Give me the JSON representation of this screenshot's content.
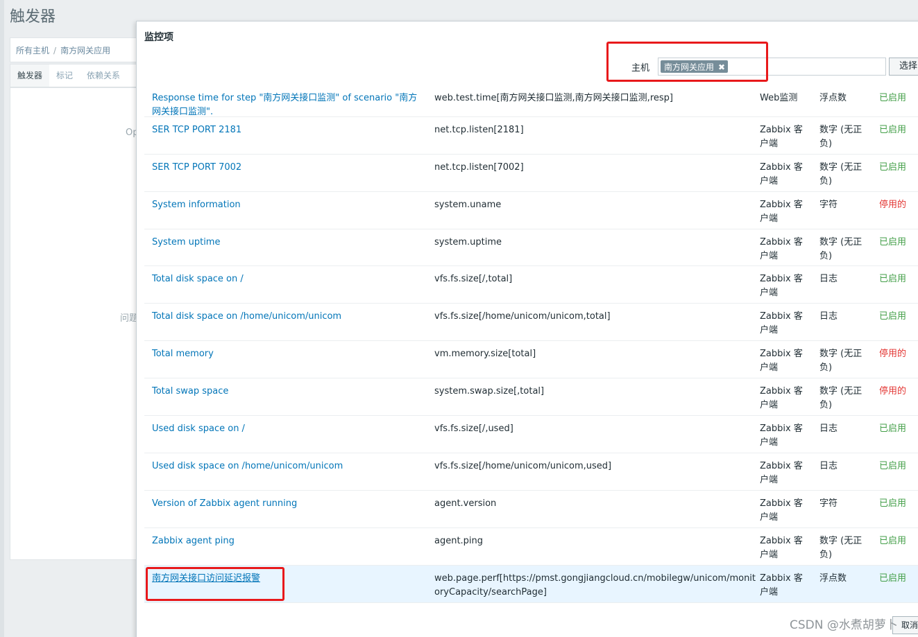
{
  "page": {
    "title": "触发器",
    "breadcrumb": [
      "所有主机",
      "南方网关应用"
    ],
    "tabs": [
      "触发器",
      "标记",
      "依赖关系"
    ],
    "fragments": [
      "Op",
      "问题"
    ]
  },
  "dialog": {
    "title": "监控项",
    "host_label": "主机",
    "host_chip": "南方网关应用",
    "select_label": "选择",
    "cancel_label": "取消"
  },
  "items": [
    {
      "name": "Response time for step \"南方网关接口监测\" of scenario \"南方网关接口监测\".",
      "key": "web.test.time[南方网关接口监测,南方网关接口监测,resp]",
      "type": "Web监测",
      "vtype": "浮点数",
      "status": "已启用",
      "enabled": true
    },
    {
      "name": "SER TCP PORT 2181",
      "key": "net.tcp.listen[2181]",
      "type": "Zabbix 客户端",
      "vtype": "数字 (无正负)",
      "status": "已启用",
      "enabled": true
    },
    {
      "name": "SER TCP PORT 7002",
      "key": "net.tcp.listen[7002]",
      "type": "Zabbix 客户端",
      "vtype": "数字 (无正负)",
      "status": "已启用",
      "enabled": true
    },
    {
      "name": "System information",
      "key": "system.uname",
      "type": "Zabbix 客户端",
      "vtype": "字符",
      "status": "停用的",
      "enabled": false
    },
    {
      "name": "System uptime",
      "key": "system.uptime",
      "type": "Zabbix 客户端",
      "vtype": "数字 (无正负)",
      "status": "已启用",
      "enabled": true
    },
    {
      "name": "Total disk space on /",
      "key": "vfs.fs.size[/,total]",
      "type": "Zabbix 客户端",
      "vtype": "日志",
      "status": "已启用",
      "enabled": true
    },
    {
      "name": "Total disk space on /home/unicom/unicom",
      "key": "vfs.fs.size[/home/unicom/unicom,total]",
      "type": "Zabbix 客户端",
      "vtype": "日志",
      "status": "已启用",
      "enabled": true
    },
    {
      "name": "Total memory",
      "key": "vm.memory.size[total]",
      "type": "Zabbix 客户端",
      "vtype": "数字 (无正负)",
      "status": "停用的",
      "enabled": false
    },
    {
      "name": "Total swap space",
      "key": "system.swap.size[,total]",
      "type": "Zabbix 客户端",
      "vtype": "数字 (无正负)",
      "status": "停用的",
      "enabled": false
    },
    {
      "name": "Used disk space on /",
      "key": "vfs.fs.size[/,used]",
      "type": "Zabbix 客户端",
      "vtype": "日志",
      "status": "已启用",
      "enabled": true
    },
    {
      "name": "Used disk space on /home/unicom/unicom",
      "key": "vfs.fs.size[/home/unicom/unicom,used]",
      "type": "Zabbix 客户端",
      "vtype": "日志",
      "status": "已启用",
      "enabled": true
    },
    {
      "name": "Version of Zabbix agent running",
      "key": "agent.version",
      "type": "Zabbix 客户端",
      "vtype": "字符",
      "status": "已启用",
      "enabled": true
    },
    {
      "name": "Zabbix agent ping",
      "key": "agent.ping",
      "type": "Zabbix 客户端",
      "vtype": "数字 (无正负)",
      "status": "已启用",
      "enabled": true
    },
    {
      "name": "南方网关接口访问延迟报警",
      "key": "web.page.perf[https://pmst.gongjiangcloud.cn/mobilegw/unicom/monitoryCapacity/searchPage]",
      "type": "Zabbix 客户端",
      "vtype": "浮点数",
      "status": "已启用",
      "enabled": true,
      "highlighted": true
    }
  ],
  "watermark": "CSDN @水煮胡萝卜",
  "colors": {
    "link": "#0275b8",
    "enabled": "#429e47",
    "disabled": "#e33734",
    "annotation": "#e8191b"
  }
}
